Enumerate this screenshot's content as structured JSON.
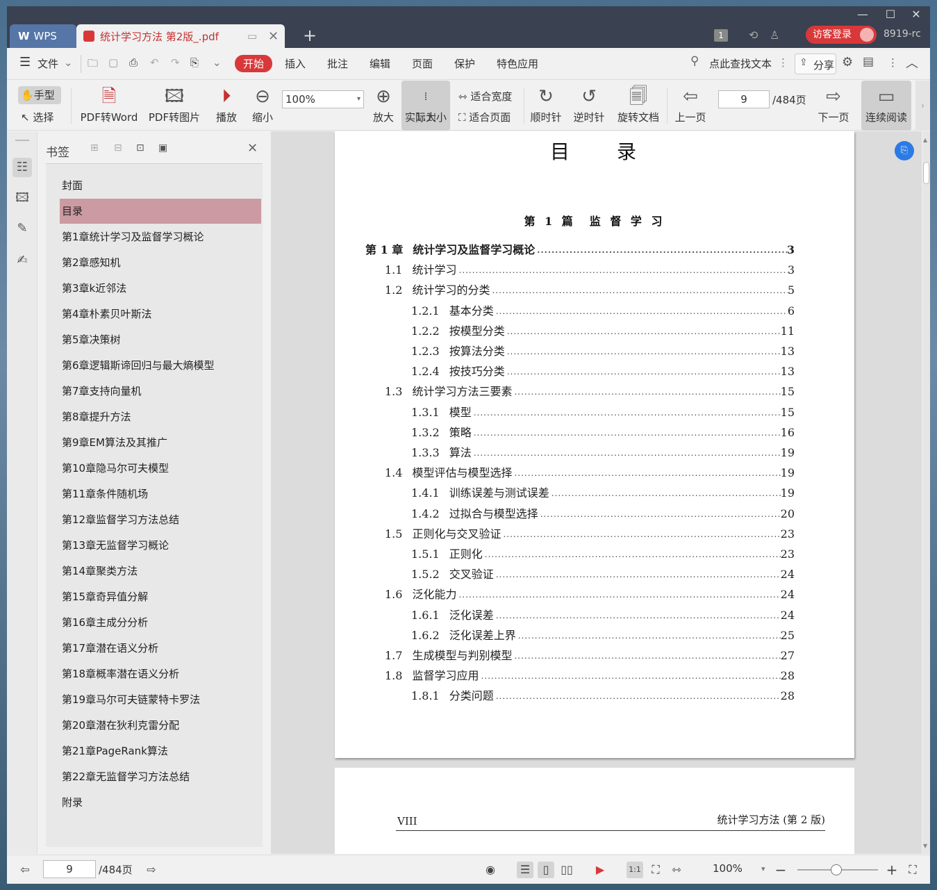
{
  "tabs": {
    "wps_label": "WPS",
    "doc_title": "统计学习方法 第2版_.pdf"
  },
  "titlebar": {
    "login_label": "访客登录",
    "user_label": "8919-rc",
    "badge": "1"
  },
  "menu": {
    "file": "文件",
    "items": [
      "开始",
      "插入",
      "批注",
      "编辑",
      "页面",
      "保护",
      "特色应用"
    ],
    "search": "点此查找文本",
    "share": "分享"
  },
  "toolbar": {
    "hand": "手型",
    "select": "选择",
    "pdf_word": "PDF转Word",
    "pdf_image": "PDF转图片",
    "play": "播放",
    "zoom_out": "缩小",
    "zoom_value": "100%",
    "zoom_in": "放大",
    "actual_size": "实际大小",
    "fit_width": "适合宽度",
    "fit_page": "适合页面",
    "clockwise": "顺时针",
    "counter": "逆时针",
    "rotate": "旋转文档",
    "prev": "上一页",
    "page_value": "9",
    "page_total": "/484页",
    "next": "下一页",
    "continuous": "连续阅读"
  },
  "bookmarks": {
    "title": "书签",
    "items": [
      "封面",
      "目录",
      "第1章统计学习及监督学习概论",
      "第2章感知机",
      "第3章k近邻法",
      "第4章朴素贝叶斯法",
      "第5章决策树",
      "第6章逻辑斯谛回归与最大熵模型",
      "第7章支持向量机",
      "第8章提升方法",
      "第9章EM算法及其推广",
      "第10章隐马尔可夫模型",
      "第11章条件随机场",
      "第12章监督学习方法总结",
      "第13章无监督学习概论",
      "第14章聚类方法",
      "第15章奇异值分解",
      "第16章主成分分析",
      "第17章潜在语义分析",
      "第18章概率潜在语义分析",
      "第19章马尔可夫链蒙特卡罗法",
      "第20章潜在狄利克雷分配",
      "第21章PageRank算法",
      "第22章无监督学习方法总结",
      "附录"
    ],
    "selected_index": 1
  },
  "page": {
    "heading": "目　　录",
    "part": "第 1 篇　监 督 学 习",
    "toc": [
      {
        "num": "第 1 章",
        "title": "统计学习及监督学习概论",
        "page": "3",
        "level": 0
      },
      {
        "num": "1.1",
        "title": "统计学习",
        "page": "3",
        "level": 1
      },
      {
        "num": "1.2",
        "title": "统计学习的分类",
        "page": "5",
        "level": 1
      },
      {
        "num": "1.2.1",
        "title": "基本分类",
        "page": "6",
        "level": 2
      },
      {
        "num": "1.2.2",
        "title": "按模型分类",
        "page": "11",
        "level": 2
      },
      {
        "num": "1.2.3",
        "title": "按算法分类",
        "page": "13",
        "level": 2
      },
      {
        "num": "1.2.4",
        "title": "按技巧分类",
        "page": "13",
        "level": 2
      },
      {
        "num": "1.3",
        "title": "统计学习方法三要素",
        "page": "15",
        "level": 1
      },
      {
        "num": "1.3.1",
        "title": "模型",
        "page": "15",
        "level": 2
      },
      {
        "num": "1.3.2",
        "title": "策略",
        "page": "16",
        "level": 2
      },
      {
        "num": "1.3.3",
        "title": "算法",
        "page": "19",
        "level": 2
      },
      {
        "num": "1.4",
        "title": "模型评估与模型选择",
        "page": "19",
        "level": 1
      },
      {
        "num": "1.4.1",
        "title": "训练误差与测试误差",
        "page": "19",
        "level": 2
      },
      {
        "num": "1.4.2",
        "title": "过拟合与模型选择",
        "page": "20",
        "level": 2
      },
      {
        "num": "1.5",
        "title": "正则化与交叉验证",
        "page": "23",
        "level": 1
      },
      {
        "num": "1.5.1",
        "title": "正则化",
        "page": "23",
        "level": 2
      },
      {
        "num": "1.5.2",
        "title": "交叉验证",
        "page": "24",
        "level": 2
      },
      {
        "num": "1.6",
        "title": "泛化能力",
        "page": "24",
        "level": 1
      },
      {
        "num": "1.6.1",
        "title": "泛化误差",
        "page": "24",
        "level": 2
      },
      {
        "num": "1.6.2",
        "title": "泛化误差上界",
        "page": "25",
        "level": 2
      },
      {
        "num": "1.7",
        "title": "生成模型与判别模型",
        "page": "27",
        "level": 1
      },
      {
        "num": "1.8",
        "title": "监督学习应用",
        "page": "28",
        "level": 1
      },
      {
        "num": "1.8.1",
        "title": "分类问题",
        "page": "28",
        "level": 2
      }
    ],
    "page2_left": "VIII",
    "page2_right": "统计学习方法 (第 2 版)"
  },
  "status": {
    "page_value": "9",
    "page_total": "/484页",
    "zoom": "100%"
  }
}
